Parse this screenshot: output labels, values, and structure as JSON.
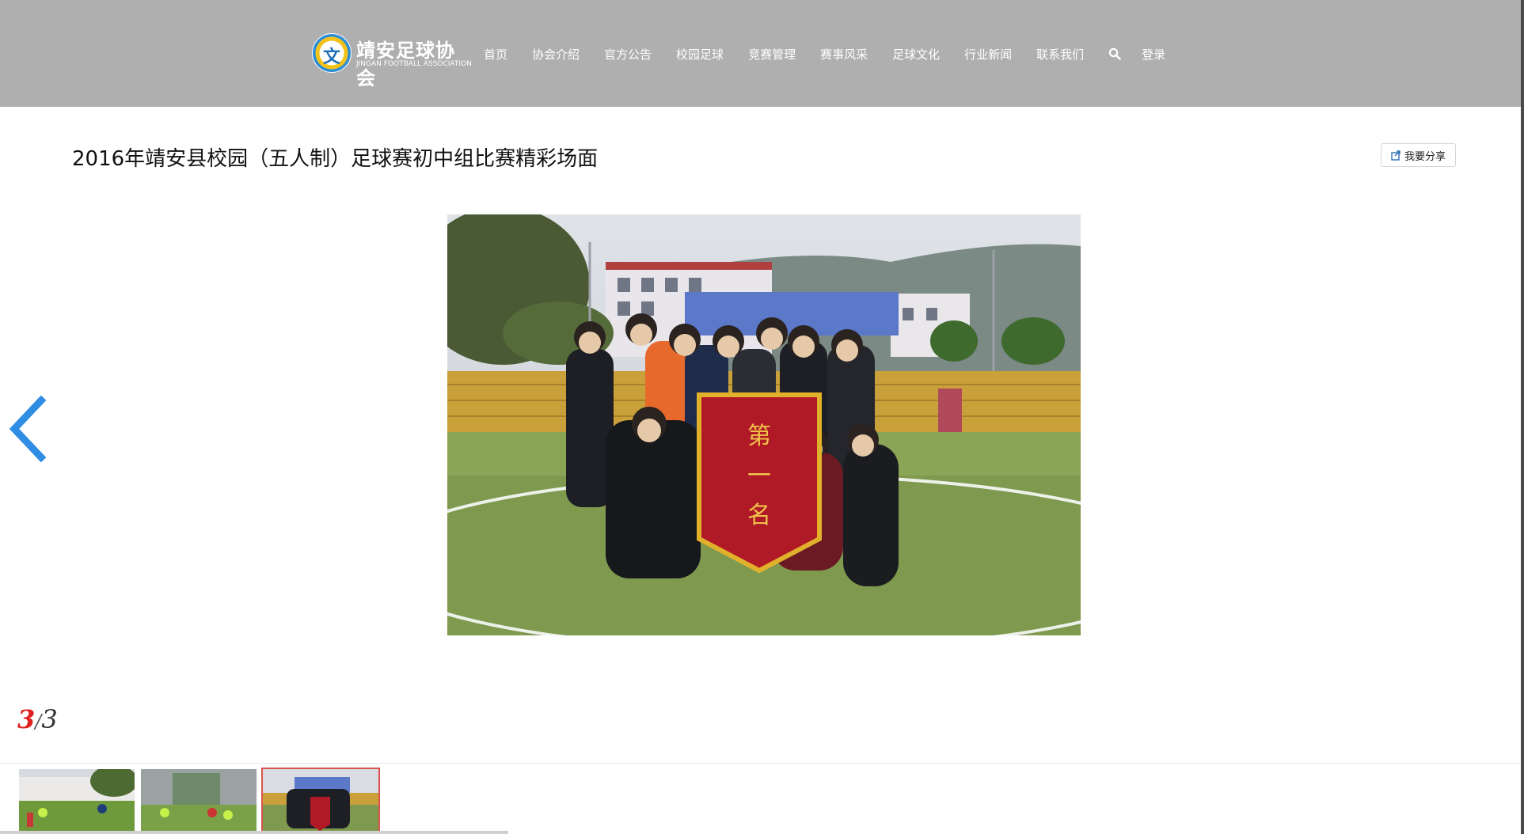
{
  "header": {
    "logo": {
      "name_cn": "靖安足球协会",
      "name_en": "JINGAN FOOTBALL ASSOCIATION",
      "badge_text": "文"
    },
    "nav": [
      {
        "label": "首页"
      },
      {
        "label": "协会介绍"
      },
      {
        "label": "官方公告"
      },
      {
        "label": "校园足球"
      },
      {
        "label": "竞赛管理"
      },
      {
        "label": "赛事风采"
      },
      {
        "label": "足球文化"
      },
      {
        "label": "行业新闻"
      },
      {
        "label": "联系我们"
      }
    ],
    "search_icon": "search-icon",
    "login_label": "登录"
  },
  "article": {
    "title": "2016年靖安县校园（五人制）足球赛初中组比赛精彩场面",
    "share_label": "我要分享"
  },
  "gallery": {
    "current": "3",
    "separator": "/",
    "total": "3",
    "prev_icon": "chevron-left-icon",
    "thumbnails": [
      {
        "selected": false
      },
      {
        "selected": false
      },
      {
        "selected": true
      }
    ]
  },
  "colors": {
    "header_bg": "#afafaf",
    "accent_blue": "#2f8de4",
    "counter_red": "#e02020",
    "active_thumb_border": "#d9534f"
  }
}
